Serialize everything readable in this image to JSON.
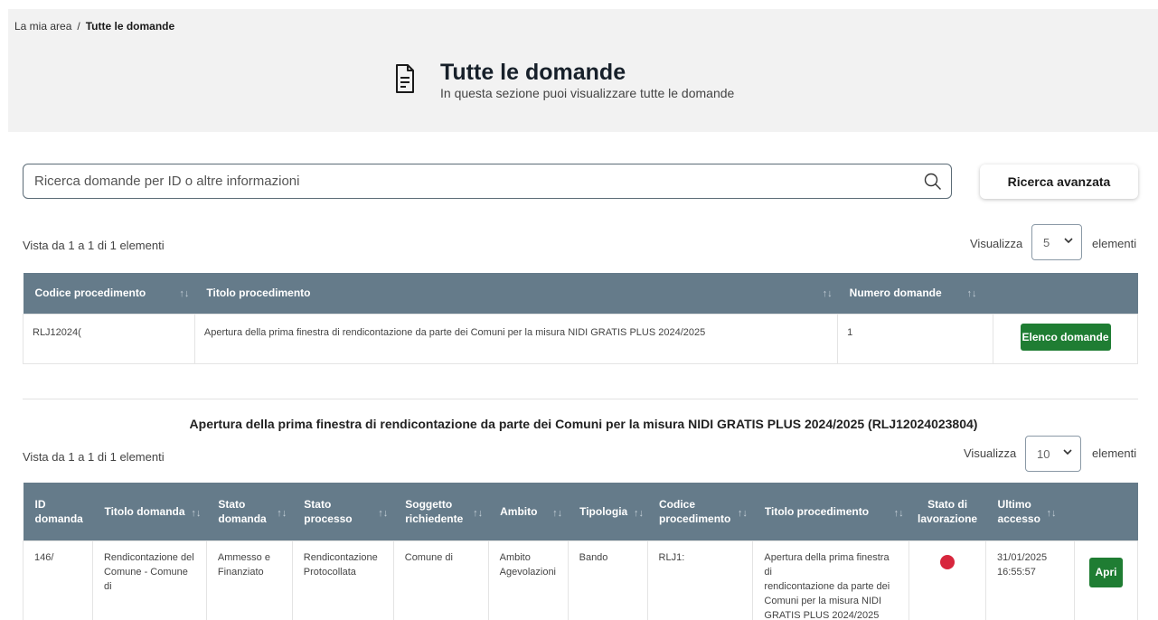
{
  "breadcrumb": {
    "root": "La mia area",
    "separator": "/",
    "current": "Tutte le domande"
  },
  "header": {
    "title": "Tutte le domande",
    "subtitle": "In questa sezione puoi visualizzare tutte le domande",
    "icon": "document-icon"
  },
  "search": {
    "placeholder": "Ricerca domande per ID o altre informazioni",
    "icon": "search-icon"
  },
  "advanced_search_label": "Ricerca avanzata",
  "procedures": {
    "info": "Vista da 1 a 1 di 1 elementi",
    "show_label": "Visualizza",
    "page_size": "5",
    "elements_label": "elementi",
    "columns": [
      "Codice procedimento",
      "Titolo procedimento",
      "Numero domande"
    ],
    "row": {
      "code": "RLJ12024(",
      "title": "Apertura della prima finestra di rendicontazione da parte dei Comuni per la misura NIDI GRATIS PLUS 2024/2025",
      "count": "1",
      "action": "Elenco domande"
    }
  },
  "applications": {
    "section_title": "Apertura della prima finestra di rendicontazione da parte dei Comuni per la misura NIDI GRATIS PLUS 2024/2025 (RLJ12024023804)",
    "info": "Vista da 1 a 1 di 1 elementi",
    "show_label": "Visualizza",
    "page_size": "10",
    "elements_label": "elementi",
    "columns": {
      "id_1": "ID",
      "id_2": "domanda",
      "titolo": "Titolo domanda",
      "stato_1": "Stato",
      "stato_2": "domanda",
      "processo_1": "Stato",
      "processo_2": "processo",
      "soggetto_1": "Soggetto",
      "soggetto_2": "richiedente",
      "ambito": "Ambito",
      "tipologia": "Tipologia",
      "codice_1": "Codice",
      "codice_2": "procedimento",
      "titolo_proc": "Titolo procedimento",
      "lavorazione_1": "Stato di",
      "lavorazione_2": "lavorazione",
      "accesso_1": "Ultimo",
      "accesso_2": "accesso"
    },
    "row": {
      "id": "146/",
      "title_1": "Rendicontazione del",
      "title_2": "Comune - Comune di",
      "status_1": "Ammesso e",
      "status_2": "Finanziato",
      "process_1": "Rendicontazione",
      "process_2": "Protocollata",
      "applicant": "Comune di",
      "scope_1": "Ambito",
      "scope_2": "Agevolazioni",
      "type": "Bando",
      "code": "RLJ1:",
      "proc_title_1": "Apertura della prima finestra di",
      "proc_title_2": "rendicontazione da parte dei",
      "proc_title_3": "Comuni per la misura NIDI",
      "proc_title_4": "GRATIS PLUS 2024/2025",
      "work_status_color": "#d7263d",
      "last_access_1": "31/01/2025",
      "last_access_2": "16:55:57",
      "action": "Apri"
    }
  }
}
